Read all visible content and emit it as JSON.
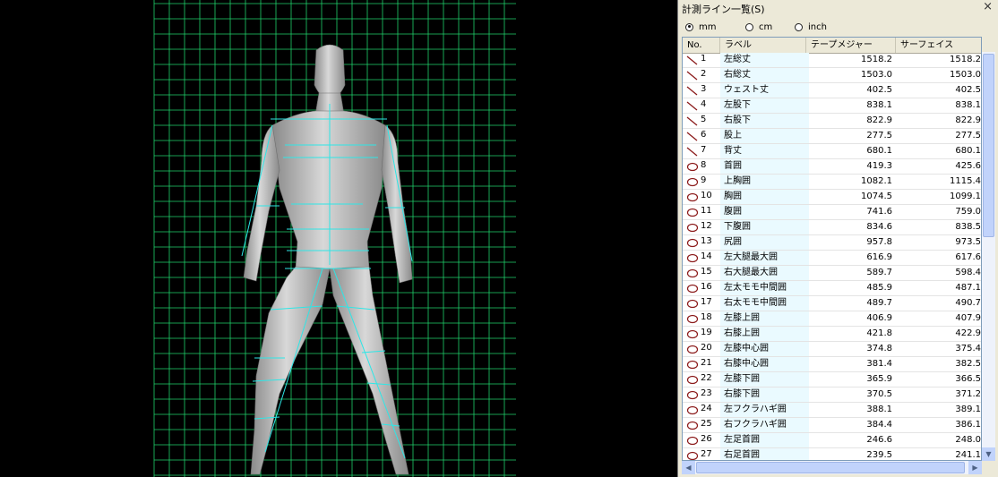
{
  "panel": {
    "title": "計測ライン一覧(S)",
    "close_glyph": "×",
    "units": [
      {
        "label": "mm",
        "selected": true
      },
      {
        "label": "cm",
        "selected": false
      },
      {
        "label": "inch",
        "selected": false
      }
    ],
    "columns": {
      "no": "No.",
      "label": "ラベル",
      "tape": "テープメジャー",
      "surface": "サーフェイス"
    },
    "rows": [
      {
        "icon": "line-icon",
        "no": "1",
        "label": "左総丈",
        "tape": "1518.2",
        "surface": "1518.2"
      },
      {
        "icon": "line-icon",
        "no": "2",
        "label": "右総丈",
        "tape": "1503.0",
        "surface": "1503.0"
      },
      {
        "icon": "line-icon",
        "no": "3",
        "label": "ウェスト丈",
        "tape": "402.5",
        "surface": "402.5"
      },
      {
        "icon": "line-icon",
        "no": "4",
        "label": "左股下",
        "tape": "838.1",
        "surface": "838.1"
      },
      {
        "icon": "line-icon",
        "no": "5",
        "label": "右股下",
        "tape": "822.9",
        "surface": "822.9"
      },
      {
        "icon": "line-icon",
        "no": "6",
        "label": "股上",
        "tape": "277.5",
        "surface": "277.5"
      },
      {
        "icon": "line-icon",
        "no": "7",
        "label": "背丈",
        "tape": "680.1",
        "surface": "680.1"
      },
      {
        "icon": "loop-icon",
        "no": "8",
        "label": "首囲",
        "tape": "419.3",
        "surface": "425.6"
      },
      {
        "icon": "loop-icon",
        "no": "9",
        "label": "上胸囲",
        "tape": "1082.1",
        "surface": "1115.4"
      },
      {
        "icon": "loop-icon",
        "no": "10",
        "label": "胸囲",
        "tape": "1074.5",
        "surface": "1099.1"
      },
      {
        "icon": "loop-icon",
        "no": "11",
        "label": "腹囲",
        "tape": "741.6",
        "surface": "759.0"
      },
      {
        "icon": "loop-icon",
        "no": "12",
        "label": "下腹囲",
        "tape": "834.6",
        "surface": "838.5"
      },
      {
        "icon": "loop-icon",
        "no": "13",
        "label": "尻囲",
        "tape": "957.8",
        "surface": "973.5"
      },
      {
        "icon": "loop-icon",
        "no": "14",
        "label": "左大腿最大囲",
        "tape": "616.9",
        "surface": "617.6"
      },
      {
        "icon": "loop-icon",
        "no": "15",
        "label": "右大腿最大囲",
        "tape": "589.7",
        "surface": "598.4"
      },
      {
        "icon": "loop-icon",
        "no": "16",
        "label": "左太モモ中間囲",
        "tape": "485.9",
        "surface": "487.1"
      },
      {
        "icon": "loop-icon",
        "no": "17",
        "label": "右太モモ中間囲",
        "tape": "489.7",
        "surface": "490.7"
      },
      {
        "icon": "loop-icon",
        "no": "18",
        "label": "左膝上囲",
        "tape": "406.9",
        "surface": "407.9"
      },
      {
        "icon": "loop-icon",
        "no": "19",
        "label": "右膝上囲",
        "tape": "421.8",
        "surface": "422.9"
      },
      {
        "icon": "loop-icon",
        "no": "20",
        "label": "左膝中心囲",
        "tape": "374.8",
        "surface": "375.4"
      },
      {
        "icon": "loop-icon",
        "no": "21",
        "label": "右膝中心囲",
        "tape": "381.4",
        "surface": "382.5"
      },
      {
        "icon": "loop-icon",
        "no": "22",
        "label": "左膝下囲",
        "tape": "365.9",
        "surface": "366.5"
      },
      {
        "icon": "loop-icon",
        "no": "23",
        "label": "右膝下囲",
        "tape": "370.5",
        "surface": "371.2"
      },
      {
        "icon": "loop-icon",
        "no": "24",
        "label": "左フクラハギ囲",
        "tape": "388.1",
        "surface": "389.1"
      },
      {
        "icon": "loop-icon",
        "no": "25",
        "label": "右フクラハギ囲",
        "tape": "384.4",
        "surface": "386.1"
      },
      {
        "icon": "loop-icon",
        "no": "26",
        "label": "左足首囲",
        "tape": "246.6",
        "surface": "248.0"
      },
      {
        "icon": "loop-icon",
        "no": "27",
        "label": "右足首囲",
        "tape": "239.5",
        "surface": "241.1"
      }
    ]
  },
  "colors": {
    "grid": "#1fd06a",
    "measure": "#2ee6e6",
    "body": "#b7b7b7",
    "label_bg": "#eafaff"
  }
}
